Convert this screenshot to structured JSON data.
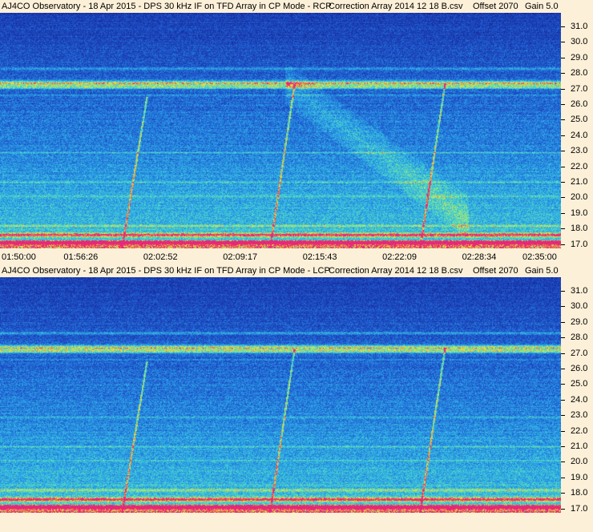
{
  "panels": [
    {
      "title": {
        "main": "AJ4CO Observatory - 18 Apr 2015 - DPS 30 kHz IF on TFD Array in CP Mode - RCP",
        "correction": "Correction Array 2014 12 18 B.csv",
        "offset": "Offset 2070",
        "gain": "Gain 5.0"
      },
      "y_labels": [
        "31.0",
        "30.0",
        "29.0",
        "28.0",
        "27.0",
        "26.0",
        "25.0",
        "24.0",
        "23.0",
        "22.0",
        "21.0",
        "20.0",
        "19.0",
        "18.0",
        "17.0"
      ],
      "x_labels": [
        "01:50:00",
        "01:56:26",
        "02:02:52",
        "02:09:17",
        "02:15:43",
        "02:22:09",
        "02:28:34",
        "02:35:00"
      ],
      "show_x_axis": true
    },
    {
      "title": {
        "main": "AJ4CO Observatory - 18 Apr 2015 - DPS 30 kHz IF on TFD Array in CP Mode - LCP",
        "correction": "Correction Array 2014 12 18 B.csv",
        "offset": "Offset 2070",
        "gain": "Gain 5.0"
      },
      "y_labels": [
        "31.0",
        "30.0",
        "29.0",
        "28.0",
        "27.0",
        "26.0",
        "25.0",
        "24.0",
        "23.0",
        "22.0",
        "21.0",
        "20.0",
        "19.0",
        "18.0",
        "17.0"
      ],
      "x_labels": [],
      "show_x_axis": false
    }
  ],
  "colors": {
    "background": "#fdf0d8",
    "spectrum_low": "#1a2fa8",
    "spectrum_mid": "#1f8fe0",
    "spectrum_high": "#f0e040",
    "spectrum_peak": "#e03070"
  }
}
